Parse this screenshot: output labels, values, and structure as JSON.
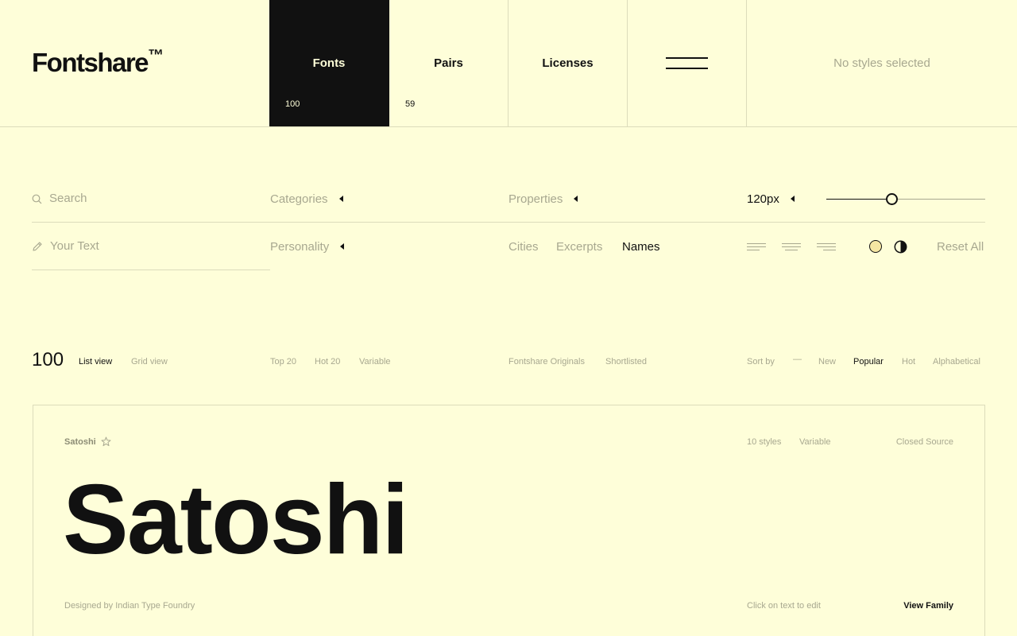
{
  "header": {
    "logo": "Fontshare",
    "logo_mark": "™",
    "tabs": [
      {
        "label": "Fonts",
        "count": "100"
      },
      {
        "label": "Pairs",
        "count": "59"
      },
      {
        "label": "Licenses"
      }
    ],
    "menu_icon": "hamburger-icon",
    "selection_status": "No styles selected"
  },
  "filters": {
    "search_placeholder": "Search",
    "categories": "Categories",
    "properties": "Properties",
    "size_value": "120px",
    "size_fraction": 0.41,
    "text_placeholder": "Your Text",
    "personality": "Personality",
    "sample_types": [
      "Cities",
      "Excerpts",
      "Names"
    ],
    "selected_sample": "Names",
    "reset": "Reset All",
    "colors": {
      "accent_light": "#f5e6a3",
      "background": "#fefed9",
      "ink": "#111111",
      "muted": "#a8a890",
      "line": "#dcdcbb"
    }
  },
  "list": {
    "count": "100",
    "views": [
      "List view",
      "Grid view"
    ],
    "active_view": "List view",
    "quick_filters": [
      "Top 20",
      "Hot 20",
      "Variable"
    ],
    "collections": [
      "Fontshare Originals",
      "Shortlisted"
    ],
    "sort_label": "Sort by",
    "sort_separator": "—",
    "sort_options": [
      "New",
      "Popular",
      "Hot",
      "Alphabetical"
    ],
    "active_sort": "Popular"
  },
  "card": {
    "name": "Satoshi",
    "styles": "10 styles",
    "variable": "Variable",
    "license": "Closed Source",
    "specimen": "Satoshi",
    "designer": "Designed by Indian Type Foundry",
    "edit_hint": "Click on text to edit",
    "view_family": "View Family"
  }
}
